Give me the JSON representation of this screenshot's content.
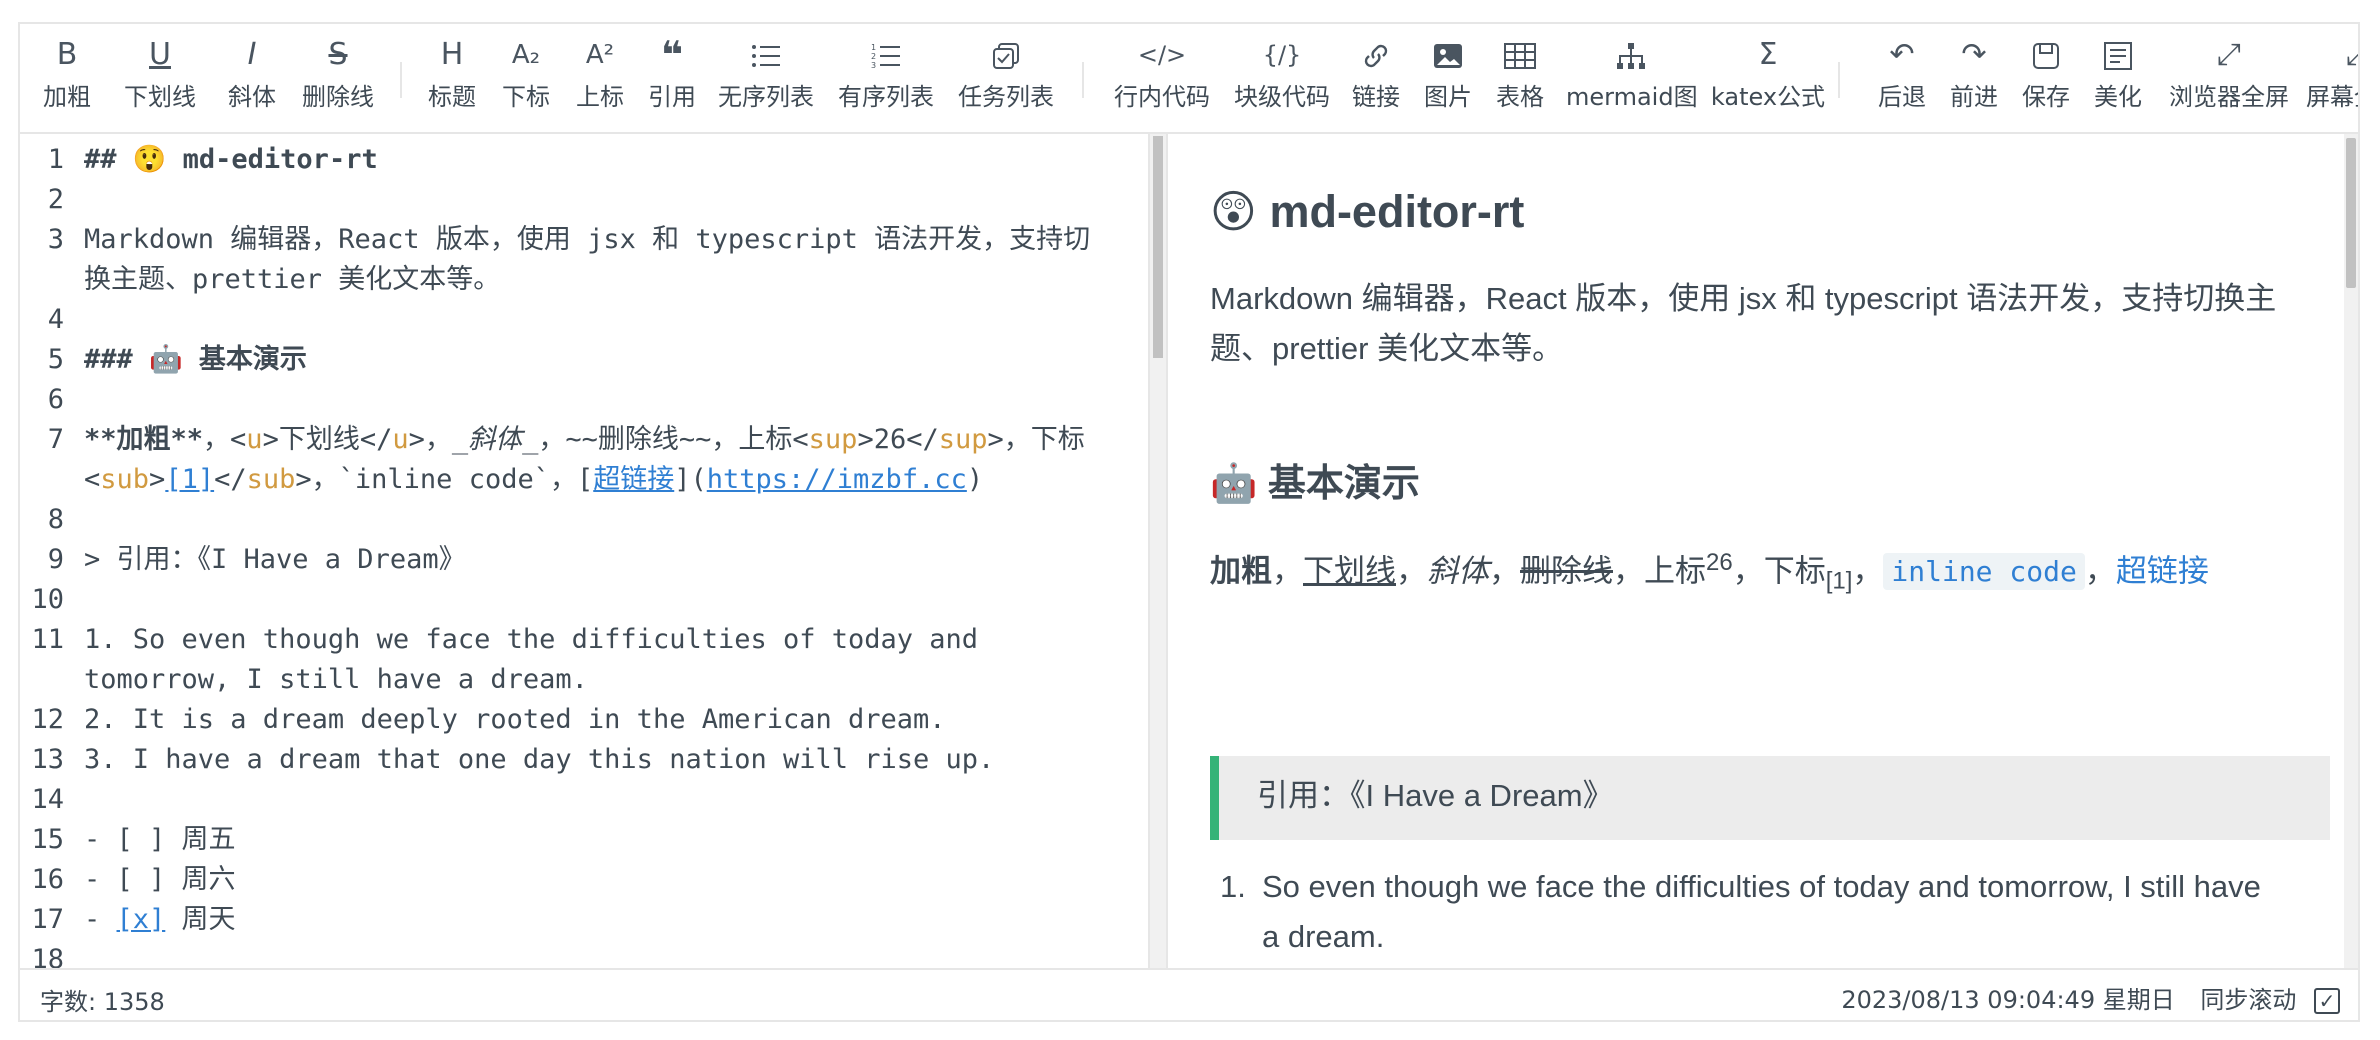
{
  "toolbar": {
    "groups": [
      [
        {
          "name": "bold",
          "icon": "B",
          "label": "加粗"
        },
        {
          "name": "underline",
          "icon": "U",
          "label": "下划线"
        },
        {
          "name": "italic",
          "icon": "I",
          "label": "斜体"
        },
        {
          "name": "strikethrough",
          "icon": "S",
          "label": "删除线"
        }
      ],
      [
        {
          "name": "heading",
          "icon": "H",
          "label": "标题"
        },
        {
          "name": "subscript",
          "icon": "A₂",
          "label": "下标"
        },
        {
          "name": "superscript",
          "icon": "A²",
          "label": "上标"
        },
        {
          "name": "quote",
          "icon": "❝",
          "label": "引用"
        },
        {
          "name": "unordered-list",
          "icon": "☰",
          "label": "无序列表"
        },
        {
          "name": "ordered-list",
          "icon": "☰",
          "label": "有序列表"
        },
        {
          "name": "task-list",
          "icon": "⧉",
          "label": "任务列表"
        }
      ],
      [
        {
          "name": "inline-code",
          "icon": "</>",
          "label": "行内代码"
        },
        {
          "name": "code-block",
          "icon": "{/}",
          "label": "块级代码"
        },
        {
          "name": "link",
          "icon": "🔗",
          "label": "链接"
        },
        {
          "name": "image",
          "icon": "▣",
          "label": "图片"
        },
        {
          "name": "table",
          "icon": "⊞",
          "label": "表格"
        },
        {
          "name": "mermaid",
          "icon": "⋔",
          "label": "mermaid图"
        },
        {
          "name": "katex",
          "icon": "Σ",
          "label": "katex公式"
        }
      ],
      [
        {
          "name": "revoke",
          "icon": "↶",
          "label": "后退"
        },
        {
          "name": "next",
          "icon": "↷",
          "label": "前进"
        },
        {
          "name": "save",
          "icon": "💾",
          "label": "保存"
        },
        {
          "name": "prettier",
          "icon": "☷",
          "label": "美化"
        },
        {
          "name": "page-fullscreen",
          "icon": "⤢",
          "label": "浏览器全屏"
        },
        {
          "name": "fullscreen",
          "icon": "⤢",
          "label": "屏幕全屏"
        }
      ]
    ]
  },
  "editor": {
    "line_numbers": [
      "1",
      "2",
      "3",
      "",
      "4",
      "5",
      "6",
      "7",
      "",
      "8",
      "9",
      "10",
      "11",
      "",
      "12",
      "13",
      "14",
      "15",
      "16",
      "17",
      "18"
    ],
    "lines": {
      "l1": "## 😲 md-editor-rt",
      "l3a": "Markdown 编辑器，React 版本，使用 jsx 和 typescript 语法开发，支持切",
      "l3b": "换主题、prettier 美化文本等。",
      "l5": "### 🤖 基本演示",
      "l7a_bold": "**加粗**",
      "l7a_1": "，<",
      "l7a_u": "u",
      "l7a_2": ">下划线</",
      "l7a_u2": "u",
      "l7a_3": ">，",
      "l7a_it": "_斜体_",
      "l7a_4": "，~~删除线~~，上标<",
      "l7a_sup": "sup",
      "l7a_5": ">26</",
      "l7a_sup2": "sup",
      "l7a_6": ">，下标",
      "l7b_1": "<",
      "l7b_sub": "sub",
      "l7b_2": ">",
      "l7b_ref": "[1]",
      "l7b_3": "</",
      "l7b_sub2": "sub",
      "l7b_4": ">，`inline code`，[",
      "l7b_link": "超链接",
      "l7b_5": "](",
      "l7b_url": "https://imzbf.cc",
      "l7b_6": ")",
      "l9": "> 引用：《I Have a Dream》",
      "l11a": "1. So even though we face the difficulties of today and",
      "l11b": "tomorrow, I still have a dream.",
      "l12": "2. It is a dream deeply rooted in the American dream.",
      "l13": "3. I have a dream that one day this nation will rise up.",
      "l15": "- [ ] 周五",
      "l16": "- [ ] 周六",
      "l17a": "- ",
      "l17x": "[x]",
      "l17b": " 周天"
    }
  },
  "preview": {
    "title_emoji": "😲",
    "title": "md-editor-rt",
    "intro_a": "Markdown 编辑器，React 版本，使用 jsx 和 typescript 语法开发，支持切换主",
    "intro_b": "题、prettier 美化文本等。",
    "section_emoji": "🤖",
    "section": "基本演示",
    "demo": {
      "bold": "加粗",
      "sep1": "，",
      "underline": "下划线",
      "sep2": "，",
      "italic": "斜体",
      "sep3": "，",
      "strike": "删除线",
      "sep4": "，上标",
      "sup": "26",
      "sep5": "，下标",
      "sub": "[1]",
      "sep6": "，",
      "code": "inline code",
      "sep7": "，",
      "link": "超链接"
    },
    "quote": "引用：《I Have a Dream》",
    "list_item_1a": "So even though we face the difficulties of today and tomorrow, I still have",
    "list_item_1b": "a dream.",
    "list_num_1": "1."
  },
  "footer": {
    "word_count": "字数: 1358",
    "datetime": "2023/08/13 09:04:49 星期日",
    "sync_scroll": "同步滚动",
    "sync_checked": "✓"
  },
  "colors": {
    "accent": "#35b378",
    "link": "#2f7fd3",
    "tag": "#d19a40",
    "text": "#3f4a54"
  }
}
